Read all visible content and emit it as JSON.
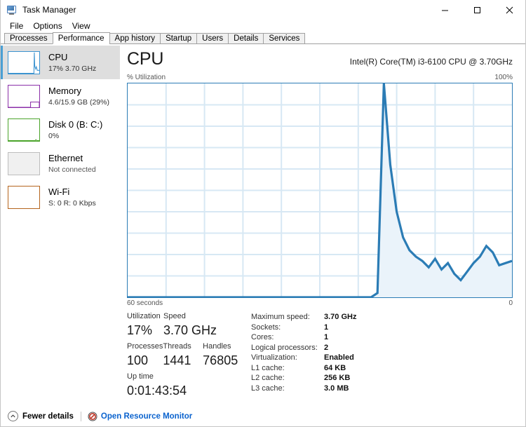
{
  "window": {
    "title": "Task Manager",
    "icon": "task-manager-icon",
    "buttons": {
      "minimize": "minimize-icon",
      "maximize": "maximize-icon",
      "close": "close-icon"
    }
  },
  "menubar": {
    "items": [
      {
        "label": "File"
      },
      {
        "label": "Options"
      },
      {
        "label": "View"
      }
    ]
  },
  "tabs": [
    {
      "label": "Processes",
      "selected": false
    },
    {
      "label": "Performance",
      "selected": true
    },
    {
      "label": "App history",
      "selected": false
    },
    {
      "label": "Startup",
      "selected": false
    },
    {
      "label": "Users",
      "selected": false
    },
    {
      "label": "Details",
      "selected": false
    },
    {
      "label": "Services",
      "selected": false
    }
  ],
  "sidebar": {
    "items": [
      {
        "title": "CPU",
        "sub": "17% 3.70 GHz",
        "selected": true,
        "accent": "#3b93d0"
      },
      {
        "title": "Memory",
        "sub": "4.6/15.9 GB (29%)",
        "selected": false,
        "accent": "#8b2fa8"
      },
      {
        "title": "Disk 0 (B: C:)",
        "sub": "0%",
        "selected": false,
        "accent": "#4aa32a"
      },
      {
        "title": "Ethernet",
        "sub": "Not connected",
        "selected": false,
        "accent": "#bdbdbd"
      },
      {
        "title": "Wi-Fi",
        "sub": "S: 0 R: 0 Kbps",
        "selected": false,
        "accent": "#b5651d"
      }
    ]
  },
  "main": {
    "title": "CPU",
    "cpu_name": "Intel(R) Core(TM) i3-6100 CPU @ 3.70GHz",
    "y_axis_label": "% Utilization",
    "y_axis_max": "100%",
    "x_axis_label": "60 seconds",
    "x_axis_end": "0"
  },
  "chart_data": {
    "type": "area",
    "title": "% Utilization",
    "xlabel": "60 seconds",
    "ylabel": "% Utilization",
    "ylim": [
      0,
      100
    ],
    "xlim": [
      60,
      0
    ],
    "grid": true,
    "grid_rows": 10,
    "grid_cols": 10,
    "line_color": "#2b7cb5",
    "fill_color": "#eaf3fa",
    "legend": "none",
    "x": [
      60,
      54,
      48,
      42,
      36,
      30,
      24,
      22,
      21,
      20,
      19,
      18,
      17,
      16,
      15,
      14,
      13,
      12,
      11,
      10,
      9,
      8,
      7,
      6,
      5,
      4,
      3,
      2,
      1,
      0
    ],
    "values": [
      0,
      0,
      0,
      0,
      0,
      0,
      0,
      0,
      2,
      100,
      62,
      40,
      28,
      22,
      19,
      17,
      14,
      18,
      13,
      16,
      11,
      8,
      12,
      16,
      19,
      24,
      21,
      15,
      16,
      17
    ]
  },
  "stats": {
    "left": [
      {
        "label": "Utilization",
        "value": "17%"
      },
      {
        "label": "Speed",
        "value": "3.70 GHz"
      },
      {
        "label": "Processes",
        "value": "100"
      },
      {
        "label": "Threads",
        "value": "1441"
      },
      {
        "label": "Handles",
        "value": "76805"
      },
      {
        "label": "Up time",
        "value": "0:01:43:54"
      }
    ],
    "specs": [
      {
        "key": "Maximum speed:",
        "value": "3.70 GHz"
      },
      {
        "key": "Sockets:",
        "value": "1"
      },
      {
        "key": "Cores:",
        "value": "1"
      },
      {
        "key": "Logical processors:",
        "value": "2"
      },
      {
        "key": "Virtualization:",
        "value": "Enabled"
      },
      {
        "key": "L1 cache:",
        "value": "64 KB"
      },
      {
        "key": "L2 cache:",
        "value": "256 KB"
      },
      {
        "key": "L3 cache:",
        "value": "3.0 MB"
      }
    ]
  },
  "footer": {
    "fewer_details": "Fewer details",
    "resource_monitor": "Open Resource Monitor"
  }
}
